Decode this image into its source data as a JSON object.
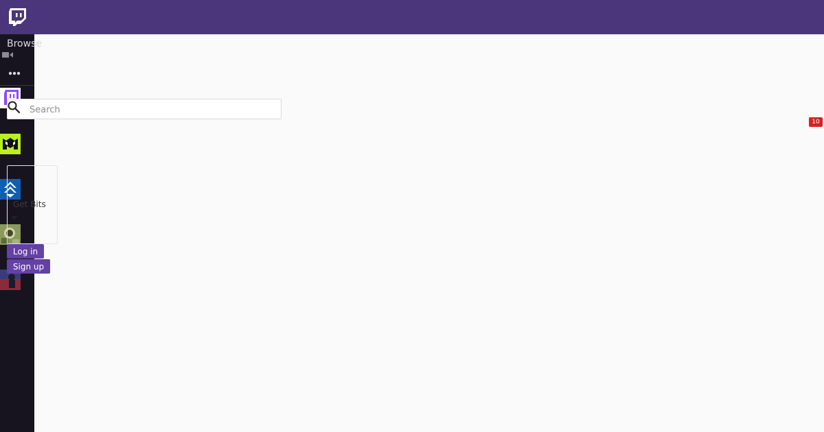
{
  "header": {
    "logo_icon": "twitch-glitch-icon",
    "brand_color": "#4b367c"
  },
  "sidebar": {
    "browse_label": "Browse",
    "video_icon": "video-camera-icon",
    "more_icon": "more-dots-icon",
    "channels": [
      {
        "icon": "twitch-channel-avatar"
      },
      {
        "icon": "monster-channel-avatar"
      },
      {
        "icon": "blue-chevron-channel-avatar"
      },
      {
        "icon": "camo-character-channel-avatar"
      },
      {
        "icon": "purple-character-channel-avatar"
      }
    ]
  },
  "search": {
    "placeholder": "Search",
    "value": ""
  },
  "bits": {
    "label": "Get Bits"
  },
  "auth": {
    "login_label": "Log in",
    "signup_label": "Sign up"
  },
  "notification": {
    "count": "10",
    "color": "#e01d1d"
  },
  "accent_color": "#6441a4"
}
